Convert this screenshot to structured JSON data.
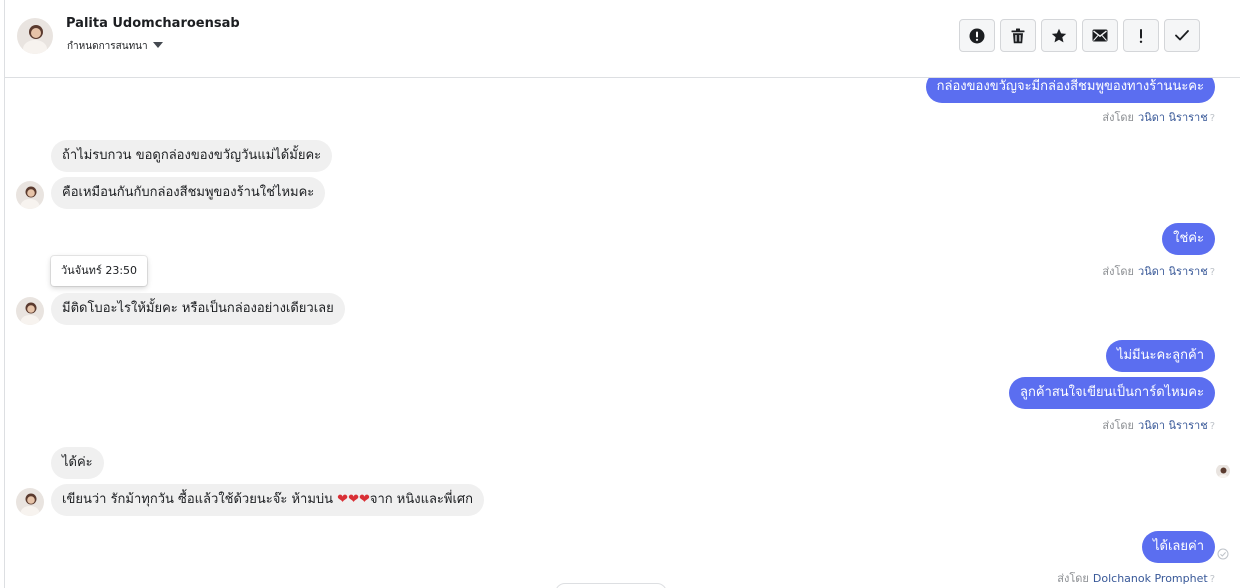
{
  "header": {
    "contact_name": "Palita Udomcharoensab",
    "conversation_status": "กำหนดการสนทนา",
    "toolbar": [
      {
        "name": "spam-button",
        "icon": "alert-circle-icon"
      },
      {
        "name": "delete-button",
        "icon": "trash-icon"
      },
      {
        "name": "star-button",
        "icon": "star-icon"
      },
      {
        "name": "mark-unread-button",
        "icon": "envelope-icon"
      },
      {
        "name": "follow-up-button",
        "icon": "exclamation-icon"
      },
      {
        "name": "mark-done-button",
        "icon": "check-icon"
      }
    ]
  },
  "thread": {
    "messages": [
      {
        "id": "m1",
        "direction": "out",
        "text": "กล่องของขวัญจะมีกล่องสีชมพูของทางร้านนะคะ"
      },
      {
        "id": "m2",
        "direction": "in",
        "text": "ถ้าไม่รบกวน ขอดูกล่องของขวัญวันแม่ได้มั้ยคะ"
      },
      {
        "id": "m3",
        "direction": "in",
        "text": "คือเหมือนกันกับกล่องสีชมพูของร้านใช่ไหมคะ"
      },
      {
        "id": "m4",
        "direction": "out",
        "text": "ใช่ค่ะ"
      },
      {
        "id": "m5",
        "direction": "in",
        "text": "มีติดโบอะไรให้มั้ยคะ หรือเป็นกล่องอย่างเดียวเลย"
      },
      {
        "id": "m6",
        "direction": "out",
        "text": "ไม่มีนะคะลูกค้า"
      },
      {
        "id": "m7",
        "direction": "out",
        "text": "ลูกค้าสนใจเขียนเป็นการ์ดไหมคะ"
      },
      {
        "id": "m8",
        "direction": "in",
        "text": "ได้ค่ะ"
      },
      {
        "id": "m9",
        "direction": "in",
        "text_before": "เขียนว่า รักม้าทุกวัน ซื้อแล้วใช้ด้วยนะจ๊ะ ห้ามบ่น ",
        "hearts": "❤❤❤",
        "text_after": "จาก หนิงและพี่เศก"
      },
      {
        "id": "m10",
        "direction": "out",
        "text": "ได้เลยค่า"
      }
    ],
    "sent_by_label": "ส่งโดย",
    "sender_1": "วนิดา นิราราช",
    "sender_2": "Dolchanok Promphet",
    "question_mark": "?",
    "timestamp_tooltip": "วันจันทร์ 23:50"
  },
  "colors": {
    "outgoing_bubble": "#5b6ef0",
    "incoming_bubble": "#f0f0f0",
    "sender_name": "#385898"
  }
}
